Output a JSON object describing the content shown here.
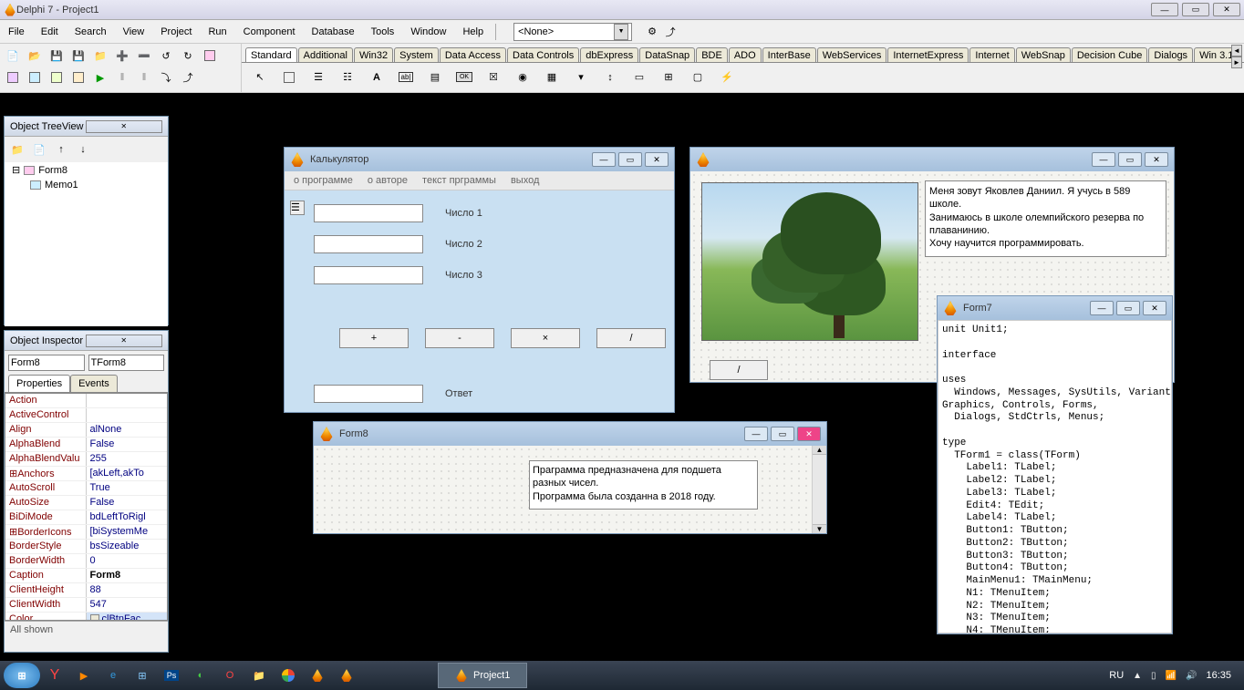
{
  "app": {
    "title": "Delphi 7 - Project1"
  },
  "menu": [
    "File",
    "Edit",
    "Search",
    "View",
    "Project",
    "Run",
    "Component",
    "Database",
    "Tools",
    "Window",
    "Help"
  ],
  "combo_value": "<None>",
  "palette_tabs": [
    "Standard",
    "Additional",
    "Win32",
    "System",
    "Data Access",
    "Data Controls",
    "dbExpress",
    "DataSnap",
    "BDE",
    "ADO",
    "InterBase",
    "WebServices",
    "InternetExpress",
    "Internet",
    "WebSnap",
    "Decision Cube",
    "Dialogs",
    "Win 3.1"
  ],
  "treeview": {
    "title": "Object TreeView",
    "root": "Form8",
    "child": "Memo1"
  },
  "inspector": {
    "title": "Object Inspector",
    "object_name": "Form8",
    "object_type": "TForm8",
    "tabs": [
      "Properties",
      "Events"
    ],
    "props": [
      {
        "name": "Action",
        "val": ""
      },
      {
        "name": "ActiveControl",
        "val": ""
      },
      {
        "name": "Align",
        "val": "alNone"
      },
      {
        "name": "AlphaBlend",
        "val": "False"
      },
      {
        "name": "AlphaBlendValu",
        "val": "255"
      },
      {
        "name": "⊞Anchors",
        "val": "[akLeft,akTo"
      },
      {
        "name": "AutoScroll",
        "val": "True"
      },
      {
        "name": "AutoSize",
        "val": "False"
      },
      {
        "name": "BiDiMode",
        "val": "bdLeftToRigl"
      },
      {
        "name": "⊞BorderIcons",
        "val": "[biSystemMe"
      },
      {
        "name": "BorderStyle",
        "val": "bsSizeable"
      },
      {
        "name": "BorderWidth",
        "val": "0"
      },
      {
        "name": "Caption",
        "val": "Form8",
        "bold": true
      },
      {
        "name": "ClientHeight",
        "val": "88"
      },
      {
        "name": "ClientWidth",
        "val": "547"
      },
      {
        "name": "Color",
        "val": "clBtnFac",
        "highlight": true
      }
    ],
    "status": "All shown"
  },
  "calc": {
    "title": "Калькулятор",
    "menu": [
      "о программе",
      "о авторе",
      "текст прграммы",
      "выход"
    ],
    "label1": "Число 1",
    "label2": "Число 2",
    "label3": "Число 3",
    "btn_plus": "+",
    "btn_minus": "-",
    "btn_mul": "×",
    "btn_div": "/",
    "answer_label": "Ответ"
  },
  "about": {
    "memo": "Меня зовут Яковлев Даниил. Я учусь в 589 школе.\nЗанимаюсь в школе олемпийского резерва по плаванинию.\nХочу научится программировать.",
    "btn": "/"
  },
  "form7": {
    "title": "Form7",
    "code": "unit Unit1;\n\ninterface\n\nuses\n  Windows, Messages, SysUtils, Variants, Class\nGraphics, Controls, Forms,\n  Dialogs, StdCtrls, Menus;\n\ntype\n  TForm1 = class(TForm)\n    Label1: TLabel;\n    Label2: TLabel;\n    Label3: TLabel;\n    Edit4: TEdit;\n    Label4: TLabel;\n    Button1: TButton;\n    Button2: TButton;\n    Button3: TButton;\n    Button4: TButton;\n    MainMenu1: TMainMenu;\n    N1: TMenuItem;\n    N2: TMenuItem;\n    N3: TMenuItem;\n    N4: TMenuItem;"
  },
  "form8": {
    "title": "Form8",
    "memo": "Праграмма предназначена для подшета разных чисел.\nПрограмма была созданна в 2018 году."
  },
  "taskbar": {
    "task_label": "Project1",
    "lang": "RU",
    "time": "16:35"
  }
}
